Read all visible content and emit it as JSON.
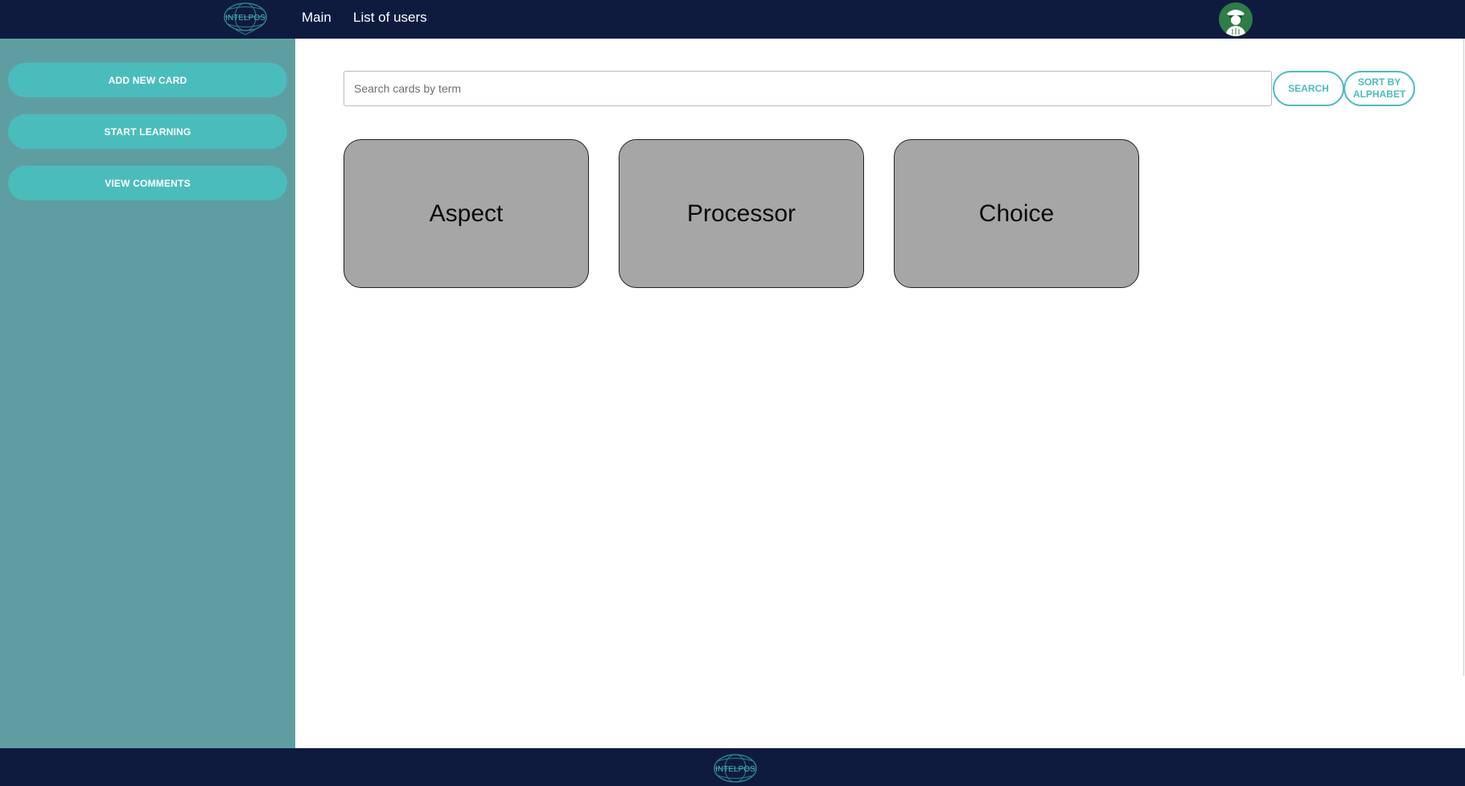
{
  "header": {
    "logo_text": "INTELPOS",
    "nav": [
      {
        "label": "Main"
      },
      {
        "label": "List of users"
      }
    ],
    "avatar_icon": "user-avatar-icon"
  },
  "sidebar": {
    "buttons": [
      {
        "label": "ADD NEW CARD"
      },
      {
        "label": "START LEARNING"
      },
      {
        "label": "VIEW COMMENTS"
      }
    ]
  },
  "search": {
    "placeholder": "Search cards by term",
    "value": "",
    "search_label": "SEARCH",
    "sort_label": "SORT BY ALPHABET"
  },
  "cards": [
    {
      "term": "Aspect"
    },
    {
      "term": "Processor"
    },
    {
      "term": "Choice"
    }
  ],
  "footer": {
    "logo_text": "INTELPOS"
  },
  "colors": {
    "header_bg": "#0e1b3f",
    "sidebar_bg": "#5f9ea0",
    "accent": "#4bbcbc",
    "card_bg": "#a6a6a6"
  }
}
